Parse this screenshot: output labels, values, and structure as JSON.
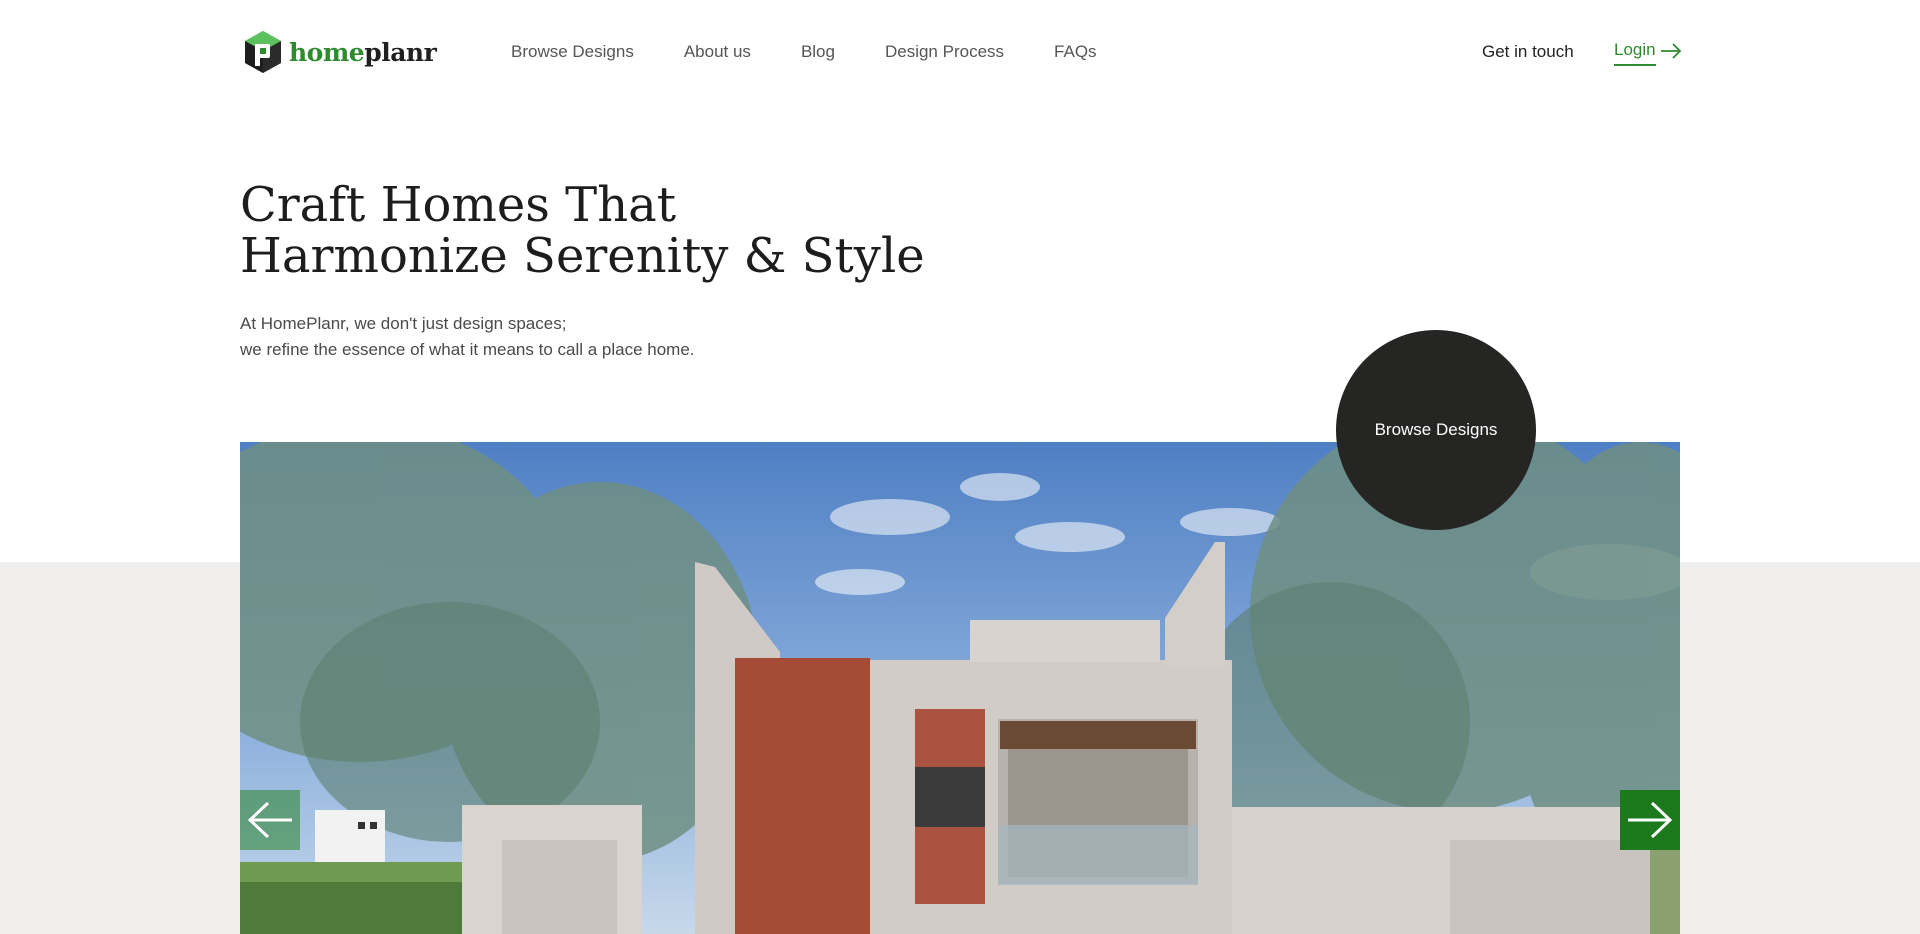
{
  "header": {
    "logo": {
      "text_home": "home",
      "text_planr": "planr"
    },
    "nav": [
      {
        "label": "Browse Designs"
      },
      {
        "label": "About us"
      },
      {
        "label": "Blog"
      },
      {
        "label": "Design Process"
      },
      {
        "label": "FAQs"
      }
    ],
    "get_in_touch": "Get in touch",
    "login": "Login"
  },
  "hero": {
    "title_line1": "Craft Homes That",
    "title_line2": "Harmonize Serenity & Style",
    "intro_line1": "At HomePlanr, we don't just design spaces;",
    "intro_line2": "we refine the essence of what it means to call a place home.",
    "cta": "Browse Designs"
  },
  "icons": {
    "logo": "hexagon-p-icon",
    "login": "arrow-right-icon",
    "prev": "arrow-left-icon",
    "next": "arrow-right-icon"
  },
  "colors": {
    "brand_green": "#2e8b2e",
    "cta_dark": "#252623",
    "band_gray": "#f0efed",
    "next_button": "#1c7a1c"
  }
}
